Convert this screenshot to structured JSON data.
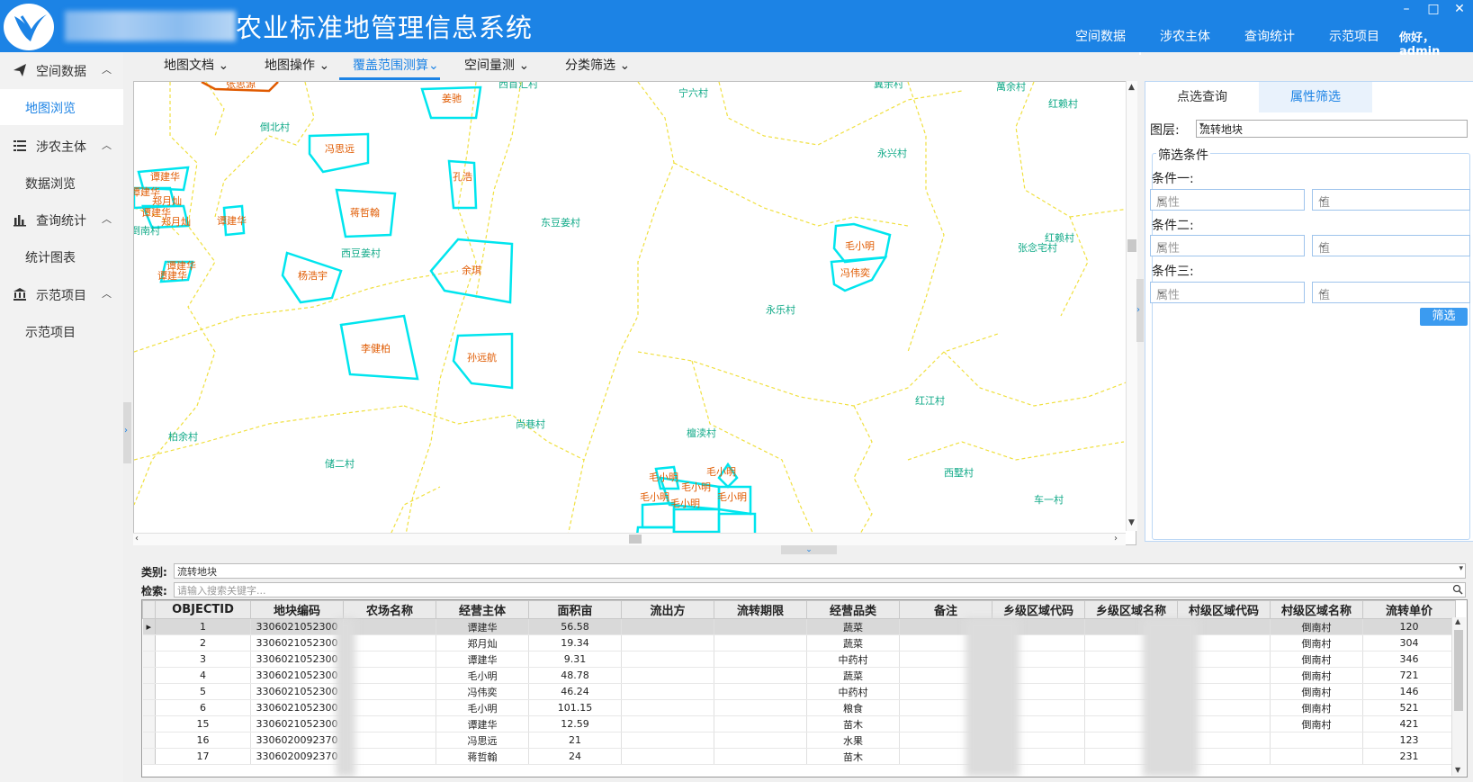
{
  "app": {
    "title": "农业标准地管理信息系统",
    "greeting": "你好，admin"
  },
  "topnav": [
    "空间数据",
    "涉农主体",
    "查询统计",
    "示范项目"
  ],
  "window_controls": [
    "–",
    "□",
    "✕"
  ],
  "sidebar": {
    "groups": [
      {
        "label": "空间数据",
        "icon": "paper-plane-icon",
        "items": [
          "地图浏览"
        ]
      },
      {
        "label": "涉农主体",
        "icon": "list-icon",
        "items": [
          "数据浏览"
        ]
      },
      {
        "label": "查询统计",
        "icon": "bar-chart-icon",
        "items": [
          "统计图表"
        ]
      },
      {
        "label": "示范项目",
        "icon": "bank-icon",
        "items": [
          "示范项目"
        ]
      }
    ],
    "active_item": "地图浏览"
  },
  "map_toolbar": [
    "地图文档",
    "地图操作",
    "覆盖范围测算",
    "空间量测",
    "分类筛选"
  ],
  "map_toolbar_active": "覆盖范围测算",
  "map": {
    "villages": [
      "西首汇村",
      "宁六村",
      "冀余村",
      "萬余村",
      "红赖村",
      "倒北村",
      "永兴村",
      "东豆姜村",
      "西豆姜村",
      "红赖村",
      "张念宅村",
      "倒南村",
      "永乐村",
      "红江村",
      "柏余村",
      "尚巷村",
      "檀渎村",
      "储二村",
      "西墅村",
      "车一村"
    ],
    "parcels": [
      "张思源",
      "姜驰",
      "冯思远",
      "孔浩",
      "谭建华",
      "谭建华",
      "郑月灿",
      "谭建华",
      "郑月灿",
      "谭建华",
      "蒋哲翰",
      "毛小明",
      "冯伟奕",
      "杨浩宇",
      "余琪",
      "谭建华",
      "谭建华",
      "李健柏",
      "孙远航",
      "毛小明",
      "毛小明",
      "毛小明",
      "毛小明",
      "毛小明",
      "毛小明"
    ]
  },
  "right_panel": {
    "tabs": [
      "点选查询",
      "属性筛选"
    ],
    "active_tab": "属性筛选",
    "layer_label": "图层:",
    "layer_value": "流转地块",
    "legend": "筛选条件",
    "conditions": [
      {
        "label": "条件一:",
        "attr_placeholder": "属性",
        "value_placeholder": "值"
      },
      {
        "label": "条件二:",
        "attr_placeholder": "属性",
        "value_placeholder": "值"
      },
      {
        "label": "条件三:",
        "attr_placeholder": "属性",
        "value_placeholder": "值"
      }
    ],
    "filter_button": "筛选"
  },
  "bottom": {
    "category_label": "类别:",
    "category_value": "流转地块",
    "search_label": "检索:",
    "search_placeholder": "请输入搜索关键字...",
    "columns": [
      "OBJECTID",
      "地块编码",
      "农场名称",
      "经营主体",
      "面积亩",
      "流出方",
      "流转期限",
      "经营品类",
      "备注",
      "乡级区域代码",
      "乡级区域名称",
      "村级区域代码",
      "村级区域名称",
      "流转单价"
    ],
    "rows": [
      {
        "id": "1",
        "code": "3306021052300",
        "farm": "",
        "owner": "谭建华",
        "area": "56.58",
        "out": "",
        "term": "",
        "type": "蔬菜",
        "note": "",
        "town_code": "",
        "town_name": "",
        "vill_code": "",
        "vill_name": "倒南村",
        "price": "120"
      },
      {
        "id": "2",
        "code": "3306021052300",
        "farm": "",
        "owner": "郑月灿",
        "area": "19.34",
        "out": "",
        "term": "",
        "type": "蔬菜",
        "note": "",
        "town_code": "",
        "town_name": "",
        "vill_code": "",
        "vill_name": "倒南村",
        "price": "304"
      },
      {
        "id": "3",
        "code": "3306021052300",
        "farm": "",
        "owner": "谭建华",
        "area": "9.31",
        "out": "",
        "term": "",
        "type": "中药村",
        "note": "",
        "town_code": "",
        "town_name": "",
        "vill_code": "",
        "vill_name": "倒南村",
        "price": "346"
      },
      {
        "id": "4",
        "code": "3306021052300",
        "farm": "",
        "owner": "毛小明",
        "area": "48.78",
        "out": "",
        "term": "",
        "type": "蔬菜",
        "note": "",
        "town_code": "",
        "town_name": "",
        "vill_code": "",
        "vill_name": "倒南村",
        "price": "721"
      },
      {
        "id": "5",
        "code": "3306021052300",
        "farm": "",
        "owner": "冯伟奕",
        "area": "46.24",
        "out": "",
        "term": "",
        "type": "中药村",
        "note": "",
        "town_code": "",
        "town_name": "",
        "vill_code": "",
        "vill_name": "倒南村",
        "price": "146"
      },
      {
        "id": "6",
        "code": "3306021052300",
        "farm": "",
        "owner": "毛小明",
        "area": "101.15",
        "out": "",
        "term": "",
        "type": "粮食",
        "note": "",
        "town_code": "",
        "town_name": "",
        "vill_code": "",
        "vill_name": "倒南村",
        "price": "521"
      },
      {
        "id": "15",
        "code": "3306021052300",
        "farm": "",
        "owner": "谭建华",
        "area": "12.59",
        "out": "",
        "term": "",
        "type": "苗木",
        "note": "",
        "town_code": "",
        "town_name": "",
        "vill_code": "",
        "vill_name": "倒南村",
        "price": "421"
      },
      {
        "id": "16",
        "code": "3306020092370",
        "farm": "",
        "owner": "冯思远",
        "area": "21",
        "out": "",
        "term": "",
        "type": "水果",
        "note": "",
        "town_code": "",
        "town_name": "",
        "vill_code": "",
        "vill_name": "",
        "price": "123"
      },
      {
        "id": "17",
        "code": "3306020092370",
        "farm": "",
        "owner": "蒋哲翰",
        "area": "24",
        "out": "",
        "term": "",
        "type": "苗木",
        "note": "",
        "town_code": "",
        "town_name": "",
        "vill_code": "",
        "vill_name": "",
        "price": "231"
      }
    ]
  },
  "colors": {
    "primary": "#1c83e5",
    "parcel": "#00e5ee",
    "boundary": "#f0e040",
    "village_label": "#11aa88",
    "parcel_label": "#e05a00"
  }
}
